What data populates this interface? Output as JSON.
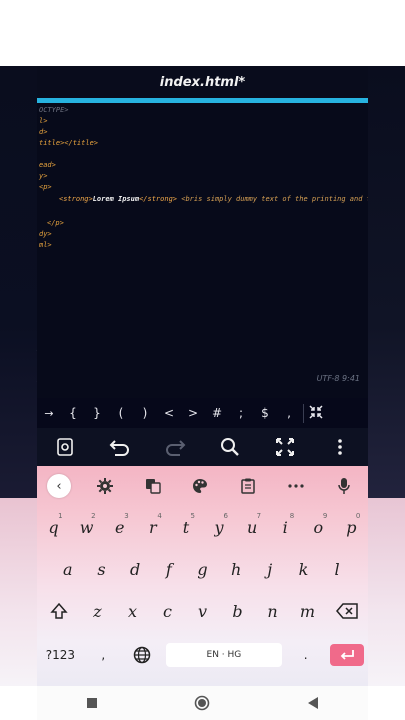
{
  "editor": {
    "title": "index.html*",
    "code_lines": [
      "OCTYPE>",
      "l>",
      "d>",
      "title></title>",
      "",
      "ead>",
      "y>",
      "<p>",
      "",
      "",
      "</p>",
      "dy>",
      "ml>"
    ],
    "body_line": {
      "strong_open": "<strong>",
      "strong_text": "Lorem Ipsum",
      "strong_close": "</strong>",
      "rest": " <bris simply dummy text of the printing and typ"
    },
    "status": "UTF-8  9:41"
  },
  "symbols": [
    "→",
    "{",
    "}",
    "(",
    ")",
    "<",
    ">",
    "#",
    ";",
    "$",
    ","
  ],
  "toolbar": {
    "items": [
      "settings-icon",
      "undo-icon",
      "redo-icon",
      "search-icon",
      "fullscreen-icon",
      "more-vert-icon"
    ]
  },
  "keyboard": {
    "tools": [
      "back-icon",
      "gear-icon",
      "translate-icon",
      "palette-icon",
      "clipboard-icon",
      "more-icon",
      "mic-icon"
    ],
    "row1": [
      {
        "k": "q",
        "s": "1"
      },
      {
        "k": "w",
        "s": "2"
      },
      {
        "k": "e",
        "s": "3"
      },
      {
        "k": "r",
        "s": "4"
      },
      {
        "k": "t",
        "s": "5"
      },
      {
        "k": "y",
        "s": "6"
      },
      {
        "k": "u",
        "s": "7"
      },
      {
        "k": "i",
        "s": "8"
      },
      {
        "k": "o",
        "s": "9"
      },
      {
        "k": "p",
        "s": "0"
      }
    ],
    "row2": [
      "a",
      "s",
      "d",
      "f",
      "g",
      "h",
      "j",
      "k",
      "l"
    ],
    "row3": [
      "z",
      "x",
      "c",
      "v",
      "b",
      "n",
      "m"
    ],
    "row4": {
      "num": "?123",
      "comma": ",",
      "space": "EN · HG",
      "period": "."
    }
  },
  "colors": {
    "accent": "#27b3e0",
    "enter": "#f06a8a",
    "editor_bg": "#070a1a"
  }
}
